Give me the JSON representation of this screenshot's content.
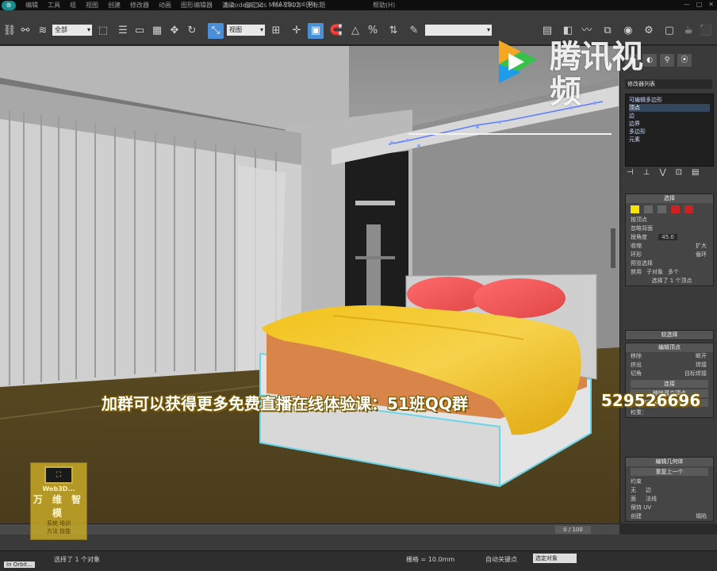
{
  "titlebar": {
    "app_icon": "3dsmax-logo-icon",
    "menus": [
      "编辑",
      "工具",
      "组",
      "视图",
      "创建",
      "修改器",
      "动画",
      "图形编辑器",
      "渲染",
      "自定义",
      "MAXScript(M)"
    ],
    "title": "Autodesk 3ds Max 2012",
    "file": "无标题",
    "help": "帮助(H)",
    "window_controls": [
      "minimize-icon",
      "maximize-icon",
      "close-icon"
    ]
  },
  "toolbar": {
    "selection_filter": "全部",
    "reference_coord": "视图",
    "named_selection": ""
  },
  "watermark": {
    "text": "腾讯视频",
    "icon": "tencent-video-play-icon",
    "colors": {
      "green": "#36c24a",
      "orange": "#f5a623",
      "blue": "#1e9be9"
    }
  },
  "promo": {
    "line": "加群可以获得更多免费直播在线体验课：51班QQ群",
    "number": "529526696"
  },
  "corner_logo": {
    "brand": "Web3D...",
    "chinese": "万 维 智 模",
    "tags": [
      "系统  培训",
      "方法  技能"
    ]
  },
  "command_panel": {
    "modifier_list_label": "修改器列表",
    "stack": [
      "可编辑多边形",
      "顶点",
      "边",
      "边界",
      "多边形",
      "元素"
    ],
    "selected_index": 1,
    "selection_rollout": {
      "title": "选择",
      "by_vertex": "按顶点",
      "ignore_backfacing": "忽略背面",
      "angle_label": "按角度",
      "angle_value": "45.0",
      "shrink": "收缩",
      "grow": "扩大",
      "ring": "环形",
      "loop": "循环",
      "preview_label": "预览选择",
      "preview_off": "禁用",
      "preview_sub": "子对象",
      "preview_multi": "多个",
      "selected_status": "选择了 1 个顶点"
    },
    "soft_selection": {
      "title": "软选择"
    },
    "edit_vertices": {
      "title": "编辑顶点",
      "remove": "移除",
      "break": "断开",
      "extrude": "挤出",
      "weld": "焊接",
      "chamfer": "切角",
      "target_weld": "目标焊接",
      "connect": "连接",
      "remove_iso": "移除孤立顶点",
      "remove_unused": "移除未使用的贴图顶点",
      "weight_label": "权重："
    },
    "edit_geometry": {
      "title": "编辑几何体",
      "repeat_last": "重复上一个",
      "constraints": "约束",
      "none": "无",
      "edge": "边",
      "face": "面",
      "normal": "法线",
      "preserve_uv": "保持 UV",
      "create": "创建",
      "collapse": "塌陷"
    }
  },
  "timeline": {
    "frame": "0 / 100"
  },
  "statusbar": {
    "prompt": "In Orbit...",
    "status": "选择了 1 个对象",
    "grid": "栅格 = 10.0mm",
    "auto_key": "自动关键点",
    "selection_set": "选定对象"
  }
}
